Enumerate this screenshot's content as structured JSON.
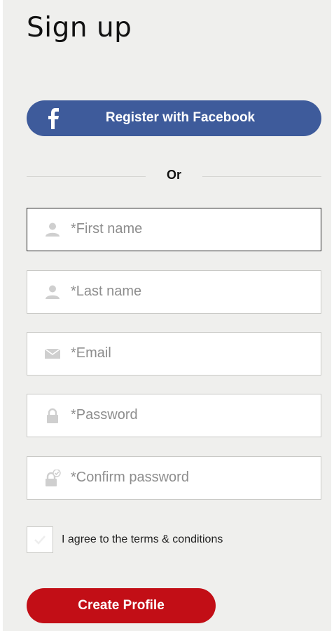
{
  "page": {
    "title": "Sign up"
  },
  "facebook": {
    "label": "Register with Facebook",
    "icon": "facebook-icon",
    "color": "#3e5b9b"
  },
  "divider": {
    "text": "Or"
  },
  "fields": {
    "first_name": {
      "placeholder": "*First name",
      "value": "",
      "icon": "user-icon"
    },
    "last_name": {
      "placeholder": "*Last name",
      "value": "",
      "icon": "user-icon"
    },
    "email": {
      "placeholder": "*Email",
      "value": "",
      "icon": "envelope-icon"
    },
    "password": {
      "placeholder": "*Password",
      "value": "",
      "icon": "lock-icon"
    },
    "confirm_password": {
      "placeholder": "*Confirm password",
      "value": "",
      "icon": "lock-check-icon"
    }
  },
  "terms": {
    "label": "I agree to the terms & conditions",
    "checked": false
  },
  "submit": {
    "label": "Create Profile",
    "color": "#c20e16"
  }
}
